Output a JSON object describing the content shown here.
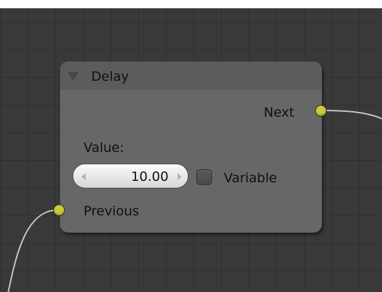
{
  "node": {
    "title": "Delay",
    "outputs": {
      "next_label": "Next"
    },
    "inputs": {
      "previous_label": "Previous"
    },
    "value_label": "Value:",
    "value_field": {
      "value": "10.00"
    },
    "variable_checkbox": {
      "label": "Variable",
      "checked": false
    }
  },
  "colors": {
    "canvas_background": "#393939",
    "node_body": "#676767",
    "socket": "#c9c93a",
    "link": "#c8c8c8"
  },
  "icons": {
    "collapse": "triangle-down-icon",
    "decrement": "arrow-left-icon",
    "increment": "arrow-right-icon"
  }
}
